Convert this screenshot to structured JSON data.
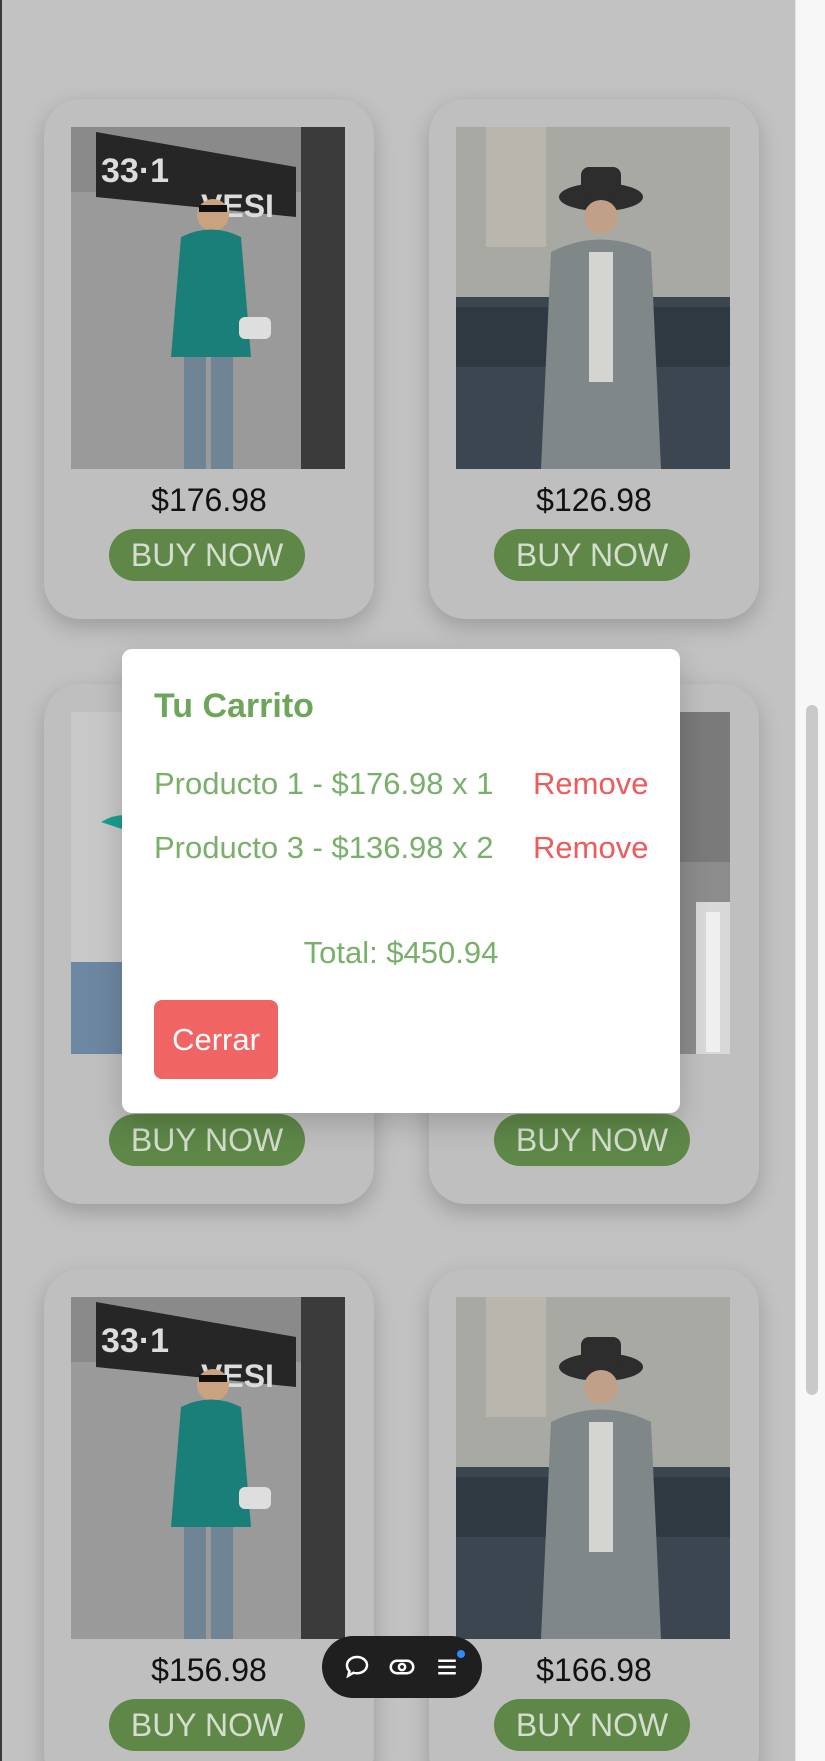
{
  "products": [
    {
      "price": "$176.98",
      "buy_label": "BUY NOW",
      "image": "woman-teal-coat"
    },
    {
      "price": "$126.98",
      "buy_label": "BUY NOW",
      "image": "woman-gray-coat-hat"
    },
    {
      "price": "",
      "buy_label": "BUY NOW",
      "image": "model-partial"
    },
    {
      "price": "",
      "buy_label": "BUY NOW",
      "image": "model-balustrade"
    },
    {
      "price": "$156.98",
      "buy_label": "BUY NOW",
      "image": "woman-teal-coat"
    },
    {
      "price": "$166.98",
      "buy_label": "BUY NOW",
      "image": "woman-gray-coat-hat"
    }
  ],
  "cart": {
    "title": "Tu Carrito",
    "items": [
      {
        "text": "Producto 1 - $176.98 x 1",
        "remove_label": "Remove"
      },
      {
        "text": "Producto 3 - $136.98 x 2",
        "remove_label": "Remove"
      }
    ],
    "total": "Total: $450.94",
    "close_label": "Cerrar"
  },
  "toolbar": {
    "icons": [
      "chat-bubble-icon",
      "eye-icon",
      "menu-list-icon"
    ],
    "notification_color": "#2d8cff"
  },
  "colors": {
    "overlay": "#c2c2c2",
    "buy_button": "#5e8748",
    "cart_text": "#78b06a",
    "remove_text": "#ef5a5a",
    "close_button": "#f06464"
  }
}
